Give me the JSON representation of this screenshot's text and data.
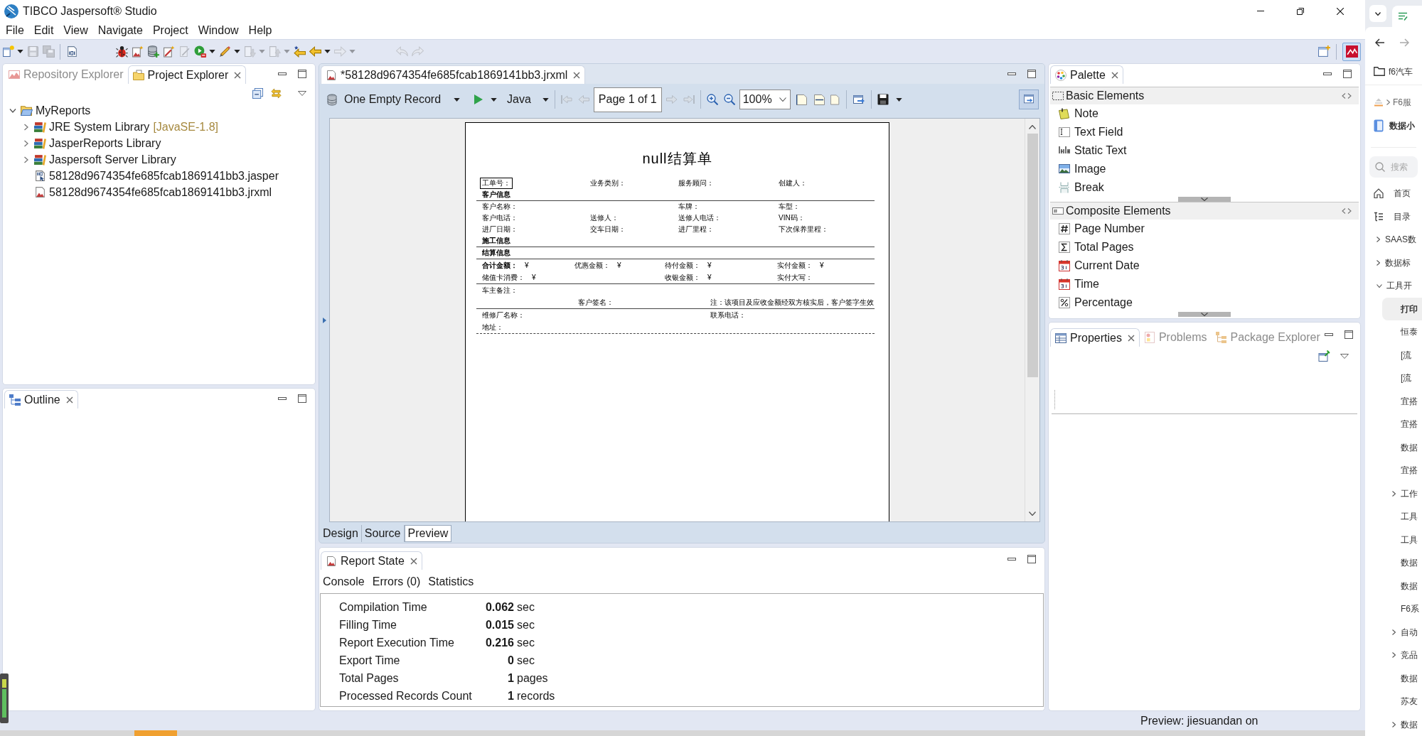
{
  "window": {
    "title": "TIBCO Jaspersoft® Studio"
  },
  "menu": [
    "File",
    "Edit",
    "View",
    "Navigate",
    "Project",
    "Window",
    "Help"
  ],
  "toolbar": {
    "buttons": [
      {
        "kind": "new",
        "dropdown": true,
        "disabled": false
      },
      {
        "kind": "save",
        "disabled": true
      },
      {
        "kind": "save-all",
        "disabled": true
      },
      {
        "kind": "binary",
        "disabled": false
      },
      {
        "kind": "bug",
        "disabled": false
      },
      {
        "kind": "picture",
        "disabled": false
      },
      {
        "kind": "database",
        "disabled": false
      },
      {
        "kind": "wand",
        "disabled": false
      },
      {
        "kind": "document",
        "disabled": true
      },
      {
        "kind": "run",
        "dropdown": true,
        "disabled": false
      },
      {
        "kind": "pencil",
        "dropdown": true,
        "disabled": false
      },
      {
        "kind": "down",
        "dropdown": true,
        "disabled": true
      },
      {
        "kind": "up",
        "dropdown": true,
        "disabled": true
      },
      {
        "kind": "last-edit",
        "disabled": false
      },
      {
        "kind": "back",
        "dropdown": true,
        "disabled": false
      },
      {
        "kind": "forward",
        "dropdown": true,
        "disabled": true
      },
      {
        "kind": "undo",
        "disabled": true
      },
      {
        "kind": "redo",
        "disabled": true
      }
    ],
    "perspectives": [
      {
        "kind": "report",
        "selected": true
      }
    ]
  },
  "project_explorer": {
    "tabs": [
      {
        "label": "Repository Explorer",
        "kind": "repository",
        "selected": false
      },
      {
        "label": "Project Explorer",
        "kind": "project",
        "selected": true
      }
    ],
    "tree": [
      {
        "label": "MyReports",
        "kind": "project",
        "expanded": true,
        "children": [
          {
            "label": "JRE System Library",
            "decoration": "[JavaSE-1.8]",
            "kind": "library",
            "expanded": false
          },
          {
            "label": "JasperReports Library",
            "kind": "library",
            "expanded": false
          },
          {
            "label": "Jaspersoft Server Library",
            "kind": "library",
            "expanded": false
          },
          {
            "label": "58128d9674354fe685fcab1869141bb3.jasper",
            "kind": "jasper"
          },
          {
            "label": "58128d9674354fe685fcab1869141bb3.jrxml",
            "kind": "jrxml"
          }
        ]
      }
    ]
  },
  "outline": {
    "tabs": [
      {
        "label": "Outline",
        "kind": "outline",
        "selected": true
      }
    ]
  },
  "editor": {
    "tabs": [
      {
        "label": "*58128d9674354fe685fcab1869141bb3.jrxml",
        "kind": "report",
        "selected": true
      }
    ],
    "preview_toolbar": {
      "data_adapter": "One Empty Record",
      "language": "Java",
      "navigation": [
        {
          "kind": "first",
          "disabled": true
        },
        {
          "kind": "previous",
          "disabled": true
        },
        {
          "kind": "next",
          "disabled": true
        },
        {
          "kind": "last",
          "disabled": true
        }
      ],
      "page": "Page 1 of 1",
      "zoom": "100%",
      "side_panel": {
        "selected": true
      }
    },
    "report": {
      "title": "null结算单",
      "rows": [
        {
          "kind": "fields",
          "cells": [
            {
              "label": "工单号：",
              "boxed": true
            },
            {
              "label": "业务类别："
            },
            {
              "label": "服务顾问："
            },
            {
              "label": "创建人："
            }
          ]
        },
        {
          "kind": "section",
          "cells": [
            {
              "label": "客户信息"
            }
          ]
        },
        {
          "kind": "rule"
        },
        {
          "kind": "fields",
          "cells": [
            {
              "label": "客户名称：",
              "wide": true
            },
            {
              "label": "车牌："
            },
            {
              "label": "车型："
            }
          ]
        },
        {
          "kind": "fields",
          "cells": [
            {
              "label": "客户电话："
            },
            {
              "label": "送修人："
            },
            {
              "label": "送修人电话："
            },
            {
              "label": "VIN码："
            }
          ]
        },
        {
          "kind": "fields",
          "cells": [
            {
              "label": "进厂日期："
            },
            {
              "label": "交车日期："
            },
            {
              "label": "进厂里程："
            },
            {
              "label": "下次保养里程："
            }
          ]
        },
        {
          "kind": "section",
          "cells": [
            {
              "label": "施工信息"
            }
          ]
        },
        {
          "kind": "rule"
        },
        {
          "kind": "section",
          "cells": [
            {
              "label": "结算信息"
            }
          ]
        },
        {
          "kind": "rule"
        },
        {
          "kind": "amounts",
          "cells": [
            {
              "label": "合计金额：",
              "value": "¥",
              "bold": true
            },
            {
              "label": "优惠金额：",
              "value": "¥"
            },
            {
              "label": "待付金额：",
              "value": "¥"
            },
            {
              "label": "实付金额：",
              "value": "¥"
            }
          ]
        },
        {
          "kind": "amounts",
          "cells": [
            {
              "label": "储值卡消费：",
              "value": "¥",
              "wide": true
            },
            {
              "label": "收银金额：",
              "value": "¥"
            },
            {
              "label": "实付大写："
            }
          ]
        },
        {
          "kind": "rule"
        },
        {
          "kind": "remark",
          "cells": [
            {
              "label": "车主备注："
            }
          ]
        },
        {
          "kind": "signature",
          "cells": [
            {
              "label": "客户签名："
            },
            {
              "label": "注：该项目及应收金额经双方核实后，客户签字生效"
            }
          ]
        },
        {
          "kind": "rule"
        },
        {
          "kind": "footer",
          "cells": [
            {
              "label": "维修厂名称："
            },
            {
              "label": "联系电话："
            }
          ]
        },
        {
          "kind": "remark",
          "cells": [
            {
              "label": "地址："
            }
          ]
        },
        {
          "kind": "dashed-rule"
        }
      ]
    },
    "bottom_tabs": [
      {
        "label": "Design",
        "selected": false
      },
      {
        "label": "Source",
        "selected": false
      },
      {
        "label": "Preview",
        "selected": true
      }
    ]
  },
  "report_state": {
    "tabs": [
      {
        "label": "Report State",
        "kind": "report",
        "selected": true
      }
    ],
    "views": [
      "Console",
      "Errors (0)",
      "Statistics"
    ],
    "statistics": [
      {
        "label": "Compilation Time",
        "value": "0.062",
        "unit": "sec"
      },
      {
        "label": "Filling Time",
        "value": "0.015",
        "unit": "sec"
      },
      {
        "label": "Report Execution Time",
        "value": "0.216",
        "unit": "sec"
      },
      {
        "label": "Export Time",
        "value": "0",
        "unit": "sec"
      },
      {
        "label": "Total Pages",
        "value": "1",
        "unit": "pages"
      },
      {
        "label": "Processed Records Count",
        "value": "1",
        "unit": "records"
      }
    ]
  },
  "palette": {
    "tabs": [
      {
        "label": "Palette",
        "kind": "palette",
        "selected": true
      }
    ],
    "groups": [
      {
        "title": "Basic Elements",
        "kind": "basic",
        "items": [
          {
            "label": "Note",
            "kind": "note"
          },
          {
            "label": "Text Field",
            "kind": "text-field"
          },
          {
            "label": "Static Text",
            "kind": "static-text"
          },
          {
            "label": "Image",
            "kind": "image"
          },
          {
            "label": "Break",
            "kind": "break"
          }
        ]
      },
      {
        "title": "Composite Elements",
        "kind": "composite",
        "items": [
          {
            "label": "Page Number",
            "kind": "page-number"
          },
          {
            "label": "Total Pages",
            "kind": "total-pages"
          },
          {
            "label": "Current Date",
            "kind": "date"
          },
          {
            "label": "Time",
            "kind": "time"
          },
          {
            "label": "Percentage",
            "kind": "percentage"
          }
        ]
      }
    ]
  },
  "properties": {
    "tabs": [
      {
        "label": "Properties",
        "kind": "properties",
        "selected": true
      },
      {
        "label": "Problems",
        "kind": "problems",
        "selected": false
      },
      {
        "label": "Package Explorer",
        "kind": "packages",
        "selected": false
      }
    ]
  },
  "status_bar": {
    "text": "Preview: jiesuandan on"
  },
  "browser_sidebar": {
    "folder": "f6汽车",
    "breadcrumb": "F6服",
    "page_title": "数据小",
    "search": {
      "placeholder": "搜索"
    },
    "nav": [
      {
        "label": "首页",
        "kind": "home",
        "selected": false
      },
      {
        "label": "目录",
        "kind": "catalog",
        "selected": false
      }
    ],
    "tree": [
      {
        "label": "SAAS数",
        "expanded": false,
        "selected": false
      },
      {
        "label": "数据标",
        "expanded": false,
        "selected": false
      },
      {
        "label": "工具开",
        "expanded": true,
        "selected": false,
        "children": [
          {
            "label": "打印",
            "selected": true
          },
          {
            "label": "恒泰",
            "selected": false
          },
          {
            "label": "[流",
            "selected": false
          },
          {
            "label": "[流",
            "selected": false
          },
          {
            "label": "宜搭",
            "selected": false
          },
          {
            "label": "宜搭",
            "selected": false
          },
          {
            "label": "数据",
            "selected": false
          },
          {
            "label": "宜搭",
            "selected": false
          },
          {
            "label": "工作",
            "expanded": false,
            "selected": false
          },
          {
            "label": "工具",
            "selected": false
          },
          {
            "label": "工具",
            "selected": false
          },
          {
            "label": "数据",
            "selected": false
          },
          {
            "label": "数据",
            "selected": false
          },
          {
            "label": "F6系",
            "selected": false
          },
          {
            "label": "自动",
            "expanded": false,
            "selected": false
          },
          {
            "label": "竞品",
            "expanded": false,
            "selected": false
          },
          {
            "label": "数据",
            "selected": false
          },
          {
            "label": "苏友",
            "selected": false
          },
          {
            "label": "数据",
            "expanded": false,
            "selected": false
          }
        ]
      }
    ]
  }
}
